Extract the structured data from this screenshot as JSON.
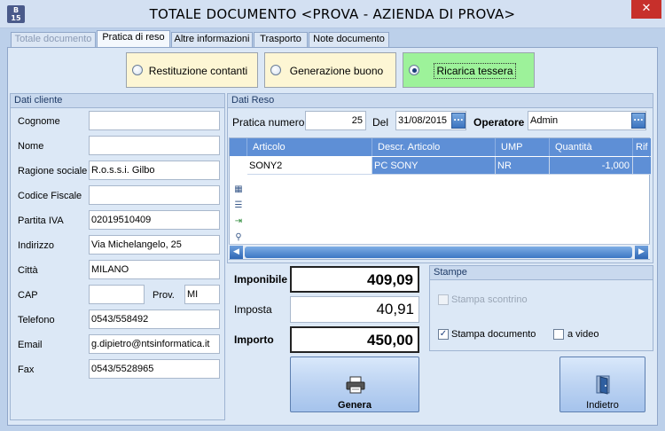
{
  "window": {
    "title": "TOTALE DOCUMENTO <PROVA - AZIENDA DI PROVA>",
    "app_badge_top": "B",
    "app_badge_bottom": "15",
    "close_glyph": "✕"
  },
  "tabs": [
    {
      "label": "Totale documento",
      "state": "disabled"
    },
    {
      "label": "Pratica di reso",
      "state": "active"
    },
    {
      "label": "Altre informazioni",
      "state": "normal"
    },
    {
      "label": "Trasporto",
      "state": "normal"
    },
    {
      "label": "Note documento",
      "state": "normal"
    }
  ],
  "options": [
    {
      "label": "Restituzione contanti",
      "selected": false
    },
    {
      "label": "Generazione buono",
      "selected": false
    },
    {
      "label": "Ricarica tessera",
      "selected": true
    }
  ],
  "dati_cliente": {
    "header": "Dati cliente",
    "fields": {
      "cognome": {
        "label": "Cognome",
        "value": ""
      },
      "nome": {
        "label": "Nome",
        "value": ""
      },
      "ragione_sociale": {
        "label": "Ragione sociale",
        "value": "R.o.s.s.i. Gilbo"
      },
      "codice_fiscale": {
        "label": "Codice Fiscale",
        "value": ""
      },
      "partita_iva": {
        "label": "Partita IVA",
        "value": "02019510409"
      },
      "indirizzo": {
        "label": "Indirizzo",
        "value": "Via Michelangelo, 25"
      },
      "citta": {
        "label": "Città",
        "value": "MILANO"
      },
      "cap": {
        "label": "CAP",
        "value": ""
      },
      "prov": {
        "label": "Prov.",
        "value": "MI"
      },
      "telefono": {
        "label": "Telefono",
        "value": "0543/558492"
      },
      "email": {
        "label": "Email",
        "value": "g.dipietro@ntsinformatica.it"
      },
      "fax": {
        "label": "Fax",
        "value": "0543/5528965"
      }
    }
  },
  "dati_reso": {
    "header": "Dati Reso",
    "pratica_label": "Pratica numero",
    "pratica_value": "25",
    "del_label": "Del",
    "del_value": "31/08/2015",
    "operatore_label": "Operatore",
    "operatore_value": "Admin",
    "ellipsis": "..."
  },
  "grid": {
    "columns": [
      "Articolo",
      "Descr. Articolo",
      "UMP",
      "Quantità",
      "Rif"
    ],
    "rows": [
      {
        "articolo": "SONY2",
        "descr": "PC SONY",
        "ump": "NR",
        "quantita": "-1,000",
        "rif": ""
      }
    ],
    "side_icons": [
      "grid-export-icon",
      "grid-list-icon",
      "grid-import-icon",
      "grid-zoom-icon"
    ]
  },
  "totals": {
    "imponibile_label": "Imponibile",
    "imponibile_value": "409,09",
    "imposta_label": "Imposta",
    "imposta_value": "40,91",
    "importo_label": "Importo",
    "importo_value": "450,00"
  },
  "stampe": {
    "header": "Stampe",
    "scontrino_label": "Stampa scontrino",
    "scontrino_checked": false,
    "scontrino_enabled": false,
    "documento_label": "Stampa documento",
    "documento_checked": true,
    "video_label": "a video",
    "video_checked": false
  },
  "buttons": {
    "genera": "Genera",
    "indietro": "Indietro"
  },
  "colors": {
    "selected_option": "#9df29a",
    "option_bg": "#fdf6d4",
    "grid_header": "#5e8fd6",
    "close_button": "#c7302b"
  }
}
